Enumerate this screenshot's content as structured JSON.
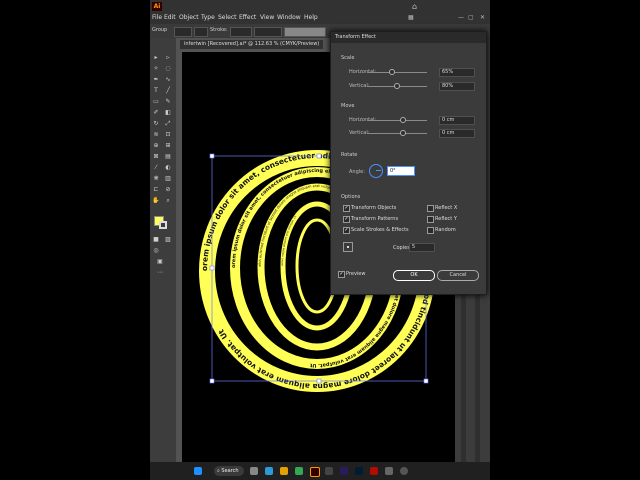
{
  "app": {
    "logo_text": "Ai",
    "menus": [
      "File",
      "Edit",
      "Object",
      "Type",
      "Select",
      "Effect",
      "View",
      "Window",
      "Help"
    ]
  },
  "control_bar": {
    "selection_label": "Group",
    "stroke_label": "Stroke:"
  },
  "document_tab": "infertwin [Recovered].ai* @ 112.63 % (CMYK/Preview)",
  "artwork": {
    "text_color": "#ffff55",
    "ring_text": "orem ipsum dolor sit amet, consectetuer adipiscing elit, sed diam nonummy nibh euismod tincidunt ut laoreet dolore magna aliquam erat volutpat. Ut",
    "ring_text_line2": "nibh euismod tincidunt ut laoreet dolore magna aliquam erat volutpat. Ut",
    "ring_text_line3": "dolore magna aliquam erat volutpat. Ut"
  },
  "dialog": {
    "title": "Transform Effect",
    "scale": {
      "section": "Scale",
      "horizontal_label": "Horizontal:",
      "horizontal_value": "65%",
      "horizontal_pct": 65,
      "vertical_label": "Vertical:",
      "vertical_value": "80%",
      "vertical_pct": 80
    },
    "move": {
      "section": "Move",
      "horizontal_label": "Horizontal:",
      "horizontal_value": "0 cm",
      "vertical_label": "Vertical:",
      "vertical_value": "0 cm"
    },
    "rotate": {
      "section": "Rotate",
      "angle_label": "Angle:",
      "angle_value": "0°"
    },
    "options": {
      "section": "Options",
      "transform_objects": "Transform Objects",
      "transform_patterns": "Transform Patterns",
      "scale_strokes": "Scale Strokes & Effects",
      "reflect_x": "Reflect X",
      "reflect_y": "Reflect Y",
      "random": "Random"
    },
    "copies_label": "Copies",
    "copies_value": "5",
    "preview_label": "Preview",
    "ok_label": "OK",
    "cancel_label": "Cancel"
  },
  "taskbar": {
    "search_label": "Search"
  }
}
